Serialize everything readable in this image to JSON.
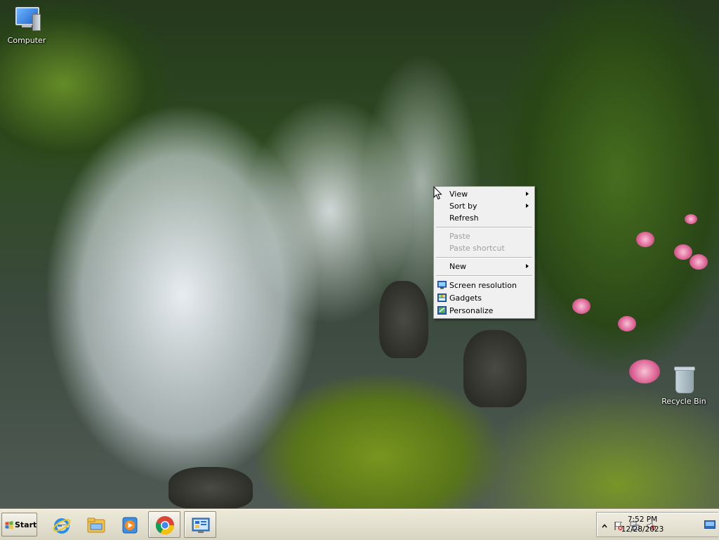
{
  "desktop": {
    "icons": [
      {
        "label": "Computer",
        "icon": "computer-icon"
      },
      {
        "label": "Recycle Bin",
        "icon": "recycle-bin-icon"
      }
    ]
  },
  "context_menu": {
    "items": [
      {
        "label": "View",
        "has_submenu": true,
        "enabled": true
      },
      {
        "label": "Sort by",
        "has_submenu": true,
        "enabled": true
      },
      {
        "label": "Refresh",
        "has_submenu": false,
        "enabled": true
      },
      {
        "label": "Paste",
        "has_submenu": false,
        "enabled": false
      },
      {
        "label": "Paste shortcut",
        "has_submenu": false,
        "enabled": false
      },
      {
        "label": "New",
        "has_submenu": true,
        "enabled": true
      },
      {
        "label": "Screen resolution",
        "has_submenu": false,
        "enabled": true,
        "icon": "screen-resolution-icon"
      },
      {
        "label": "Gadgets",
        "has_submenu": false,
        "enabled": true,
        "icon": "gadgets-icon"
      },
      {
        "label": "Personalize",
        "has_submenu": false,
        "enabled": true,
        "icon": "personalize-icon"
      }
    ]
  },
  "taskbar": {
    "start_label": "Start",
    "pinned": [
      {
        "icon": "internet-explorer-icon"
      },
      {
        "icon": "file-explorer-icon"
      },
      {
        "icon": "media-player-icon"
      },
      {
        "icon": "chrome-icon",
        "active": true
      },
      {
        "icon": "server-manager-icon",
        "active": true
      }
    ],
    "tray": {
      "icons": [
        "show-hidden-icons-chevron",
        "action-center-flag-icon",
        "network-icon",
        "volume-muted-icon"
      ],
      "time": "7:52 PM",
      "date": "12/28/2023"
    }
  },
  "colors": {
    "menu_bg": "#f0f0f0",
    "taskbar_bg": "#e4e0cf",
    "disabled_text": "#a0a0a0"
  }
}
